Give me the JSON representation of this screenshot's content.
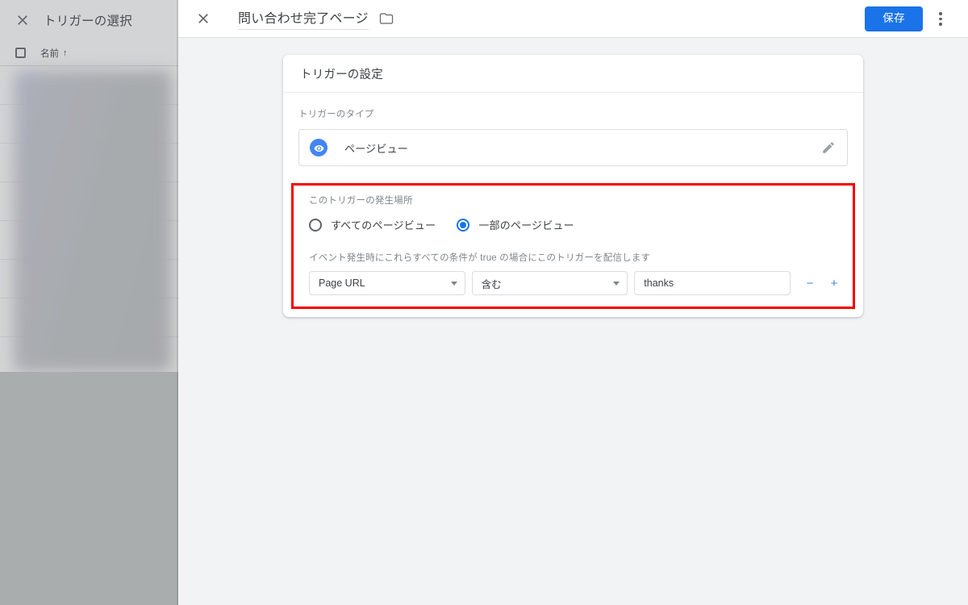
{
  "left_panel": {
    "close_icon": "close-icon",
    "title": "トリガーの選択",
    "column_header": {
      "checkbox": "select-all-checkbox",
      "label": "名前",
      "sort_arrow": "↑"
    }
  },
  "topbar": {
    "close_icon": "close-icon",
    "title": "問い合わせ完了ページ",
    "folder_icon": "folder-icon",
    "save_label": "保存",
    "menu_icon": "more-vert-icon"
  },
  "card": {
    "header": "トリガーの設定",
    "trigger_type": {
      "label": "トリガーのタイプ",
      "icon": "visibility-icon",
      "value": "ページビュー",
      "edit_icon": "pencil-icon"
    },
    "fires_on": {
      "label": "このトリガーの発生場所",
      "options": [
        {
          "label": "すべてのページビュー",
          "selected": false
        },
        {
          "label": "一部のページビュー",
          "selected": true
        }
      ]
    },
    "conditions": {
      "label": "イベント発生時にこれらすべての条件が true の場合にこのトリガーを配信します",
      "rows": [
        {
          "variable": "Page URL",
          "operator": "含む",
          "value": "thanks",
          "remove_label": "−",
          "add_label": "+"
        }
      ]
    }
  },
  "colors": {
    "accent": "#1a73e8",
    "icon_blue": "#4285f4",
    "highlight_red": "#f40000",
    "background": "#f1f3f4"
  }
}
